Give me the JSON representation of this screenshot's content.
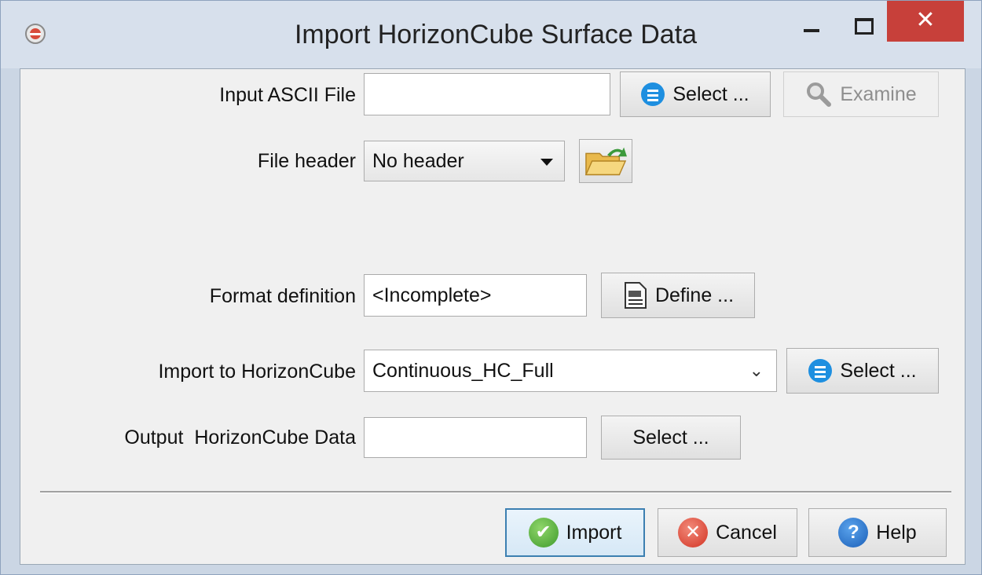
{
  "window": {
    "title": "Import HorizonCube Surface Data",
    "close_glyph": "✕"
  },
  "form": {
    "input_file": {
      "label": "Input ASCII File",
      "value": "",
      "select_label": "Select ...",
      "examine_label": "Examine"
    },
    "file_header": {
      "label": "File header",
      "selected": "No header"
    },
    "format": {
      "label": "Format definition",
      "value": "<Incomplete>",
      "define_label": "Define ..."
    },
    "import_to": {
      "label": "Import to HorizonCube",
      "selected": "Continuous_HC_Full",
      "select_label": "Select ..."
    },
    "output": {
      "label": "Output  HorizonCube Data",
      "value": "",
      "select_label": "Select ..."
    }
  },
  "buttons": {
    "import": "Import",
    "cancel": "Cancel",
    "help": "Help"
  },
  "icons": {
    "app": "opendtect-icon",
    "select": "list-icon",
    "examine": "magnifier-icon",
    "open_header": "folder-open-icon",
    "define": "document-icon",
    "import": "checkmark-icon",
    "cancel": "cancel-icon",
    "help": "help-icon"
  },
  "colors": {
    "accent": "#1e8fe0",
    "close": "#c7403a",
    "ok": "#3f9a2c",
    "cancel": "#d23323",
    "help": "#1b5fb8"
  }
}
